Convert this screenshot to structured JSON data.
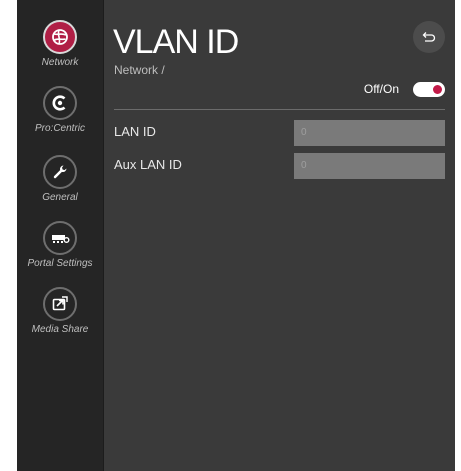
{
  "sidebar": {
    "items": [
      {
        "label": "Network",
        "icon": "globe-icon",
        "active": true
      },
      {
        "label": "Pro:Centric",
        "icon": "procentric-icon",
        "active": false
      },
      {
        "label": "General",
        "icon": "wrench-icon",
        "active": false
      },
      {
        "label": "Portal Settings",
        "icon": "portal-settings-icon",
        "active": false
      },
      {
        "label": "Media Share",
        "icon": "media-share-icon",
        "active": false
      }
    ]
  },
  "page": {
    "title": "VLAN ID",
    "breadcrumb": "Network /",
    "back_icon": "back-arrow-icon"
  },
  "toggle": {
    "label": "Off/On",
    "state": "on",
    "accent": "#c21a48"
  },
  "fields": [
    {
      "label": "LAN ID",
      "value": "0"
    },
    {
      "label": "Aux LAN ID",
      "value": "0"
    }
  ],
  "colors": {
    "active_nav": "#b01e45",
    "panel": "#3a3a3a",
    "sidebar": "#252525"
  }
}
